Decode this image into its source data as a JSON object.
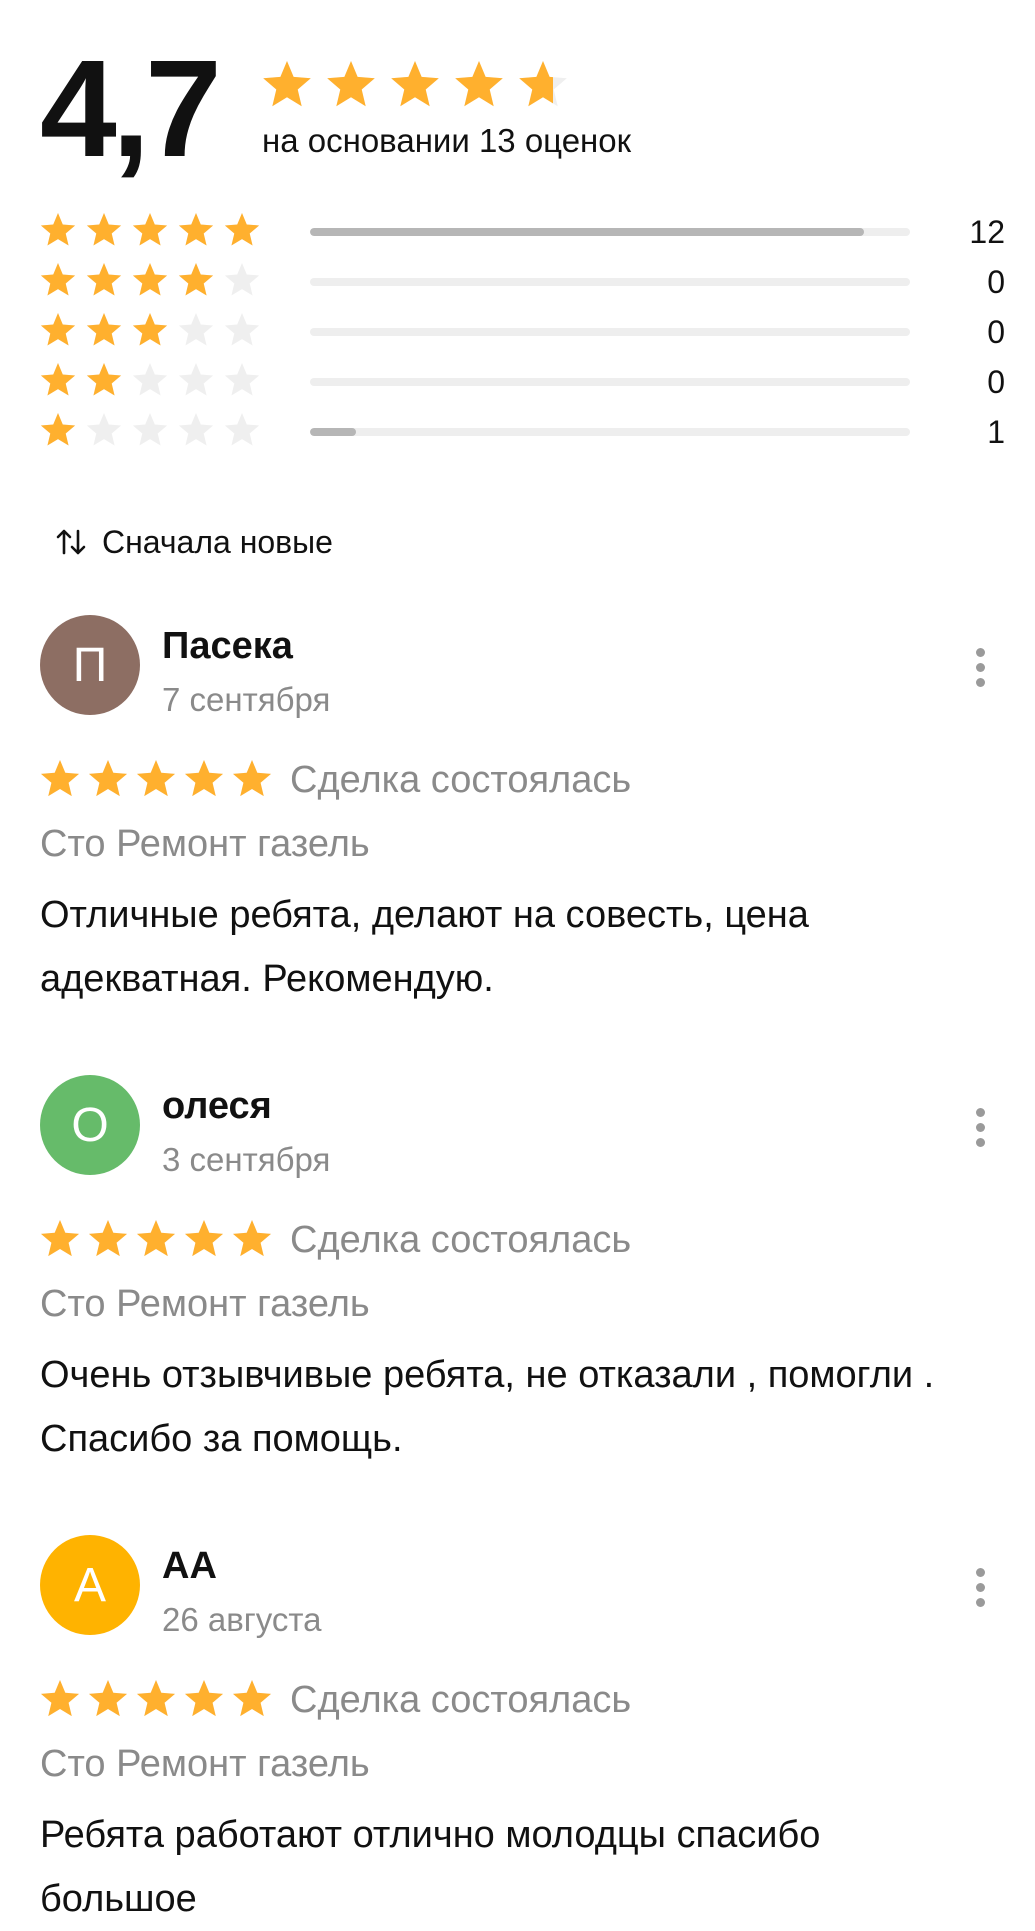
{
  "summary": {
    "score": "4,7",
    "based_on": "на основании 13 оценок",
    "stars_value": 4.7
  },
  "distribution": [
    {
      "stars": 5,
      "count": "12",
      "fraction": 0.923
    },
    {
      "stars": 4,
      "count": "0",
      "fraction": 0
    },
    {
      "stars": 3,
      "count": "0",
      "fraction": 0
    },
    {
      "stars": 2,
      "count": "0",
      "fraction": 0
    },
    {
      "stars": 1,
      "count": "1",
      "fraction": 0.077
    }
  ],
  "sort": {
    "label": "Сначала новые",
    "icon": "sort-arrows-icon"
  },
  "reviews": [
    {
      "avatar_letter": "П",
      "avatar_color": "#8D6E63",
      "author": "Пасека",
      "date": "7 сентября",
      "stars": 5,
      "deal": "Сделка состоялась",
      "service": "Сто Ремонт газель",
      "text": "Отличные ребята, делают на совесть, цена адекватная. Рекомендую."
    },
    {
      "avatar_letter": "О",
      "avatar_color": "#66BB6A",
      "author": "олеся",
      "date": "3 сентября",
      "stars": 5,
      "deal": "Сделка состоялась",
      "service": "Сто Ремонт газель",
      "text": "Очень отзывчивые ребята, не отказали , помогли . Спасибо за помощь."
    },
    {
      "avatar_letter": "А",
      "avatar_color": "#FFB300",
      "author": "АА",
      "date": "26 августа",
      "stars": 5,
      "deal": "Сделка состоялась",
      "service": "Сто Ремонт газель",
      "text": "Ребята работают отлично молодцы спасибо большое"
    }
  ],
  "colors": {
    "star": "#FFB02E",
    "star_empty": "#EFEFEF",
    "bar_fill": "#B6B6B6",
    "bar_track": "#EEEEEE",
    "muted_text": "#8A8A8A"
  }
}
